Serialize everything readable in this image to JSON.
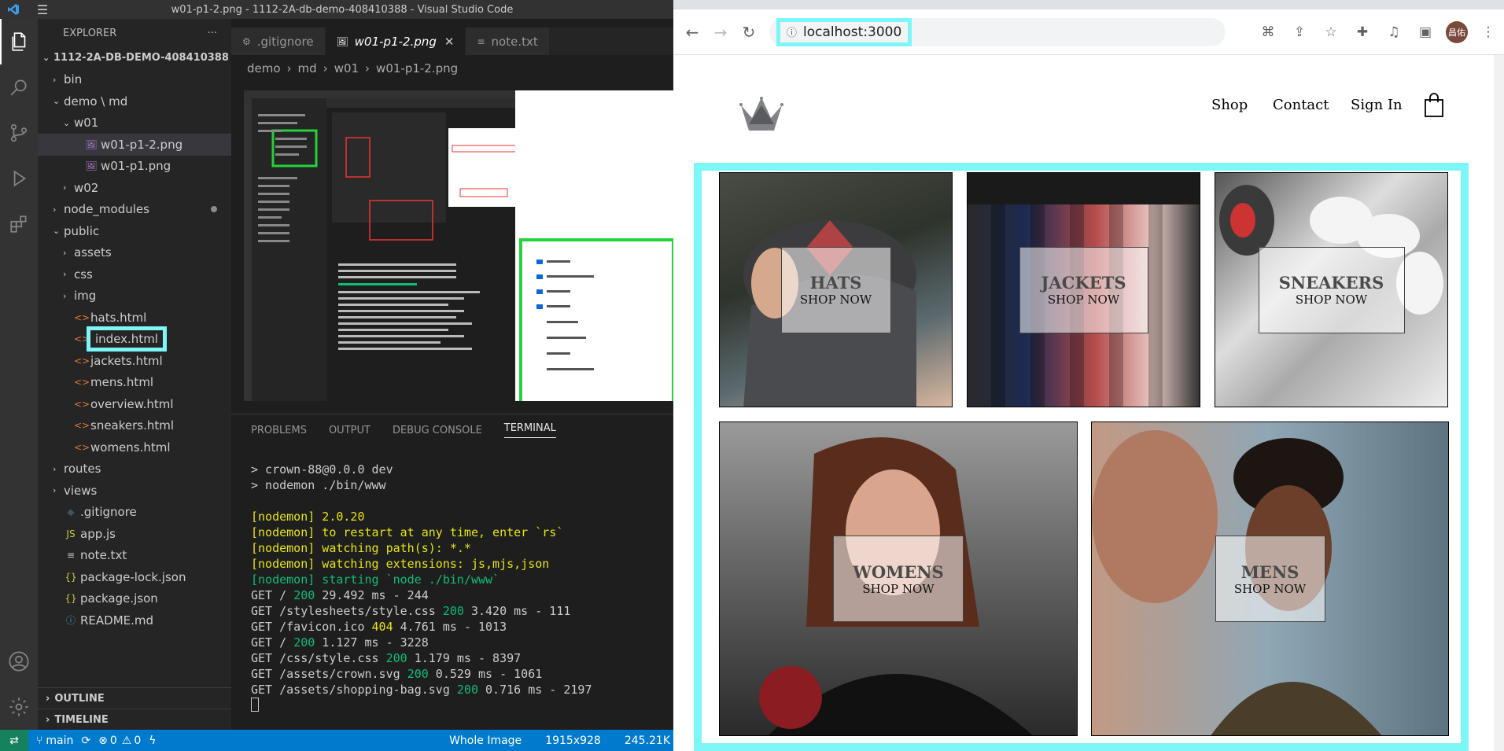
{
  "vscode": {
    "title": "w01-p1-2.png - 1112-2A-db-demo-408410388 - Visual Studio Code",
    "explorer_label": "EXPLORER",
    "tree": [
      {
        "label": "1112-2A-DB-DEMO-408410388",
        "indent": 0,
        "type": "root",
        "chev": "v"
      },
      {
        "label": "bin",
        "indent": 1,
        "type": "folder",
        "chev": ">"
      },
      {
        "label": "demo \\ md",
        "indent": 1,
        "type": "folder",
        "chev": "v"
      },
      {
        "label": "w01",
        "indent": 2,
        "type": "folder",
        "chev": "v"
      },
      {
        "label": "w01-p1-2.png",
        "indent": 3,
        "type": "image",
        "sel": true
      },
      {
        "label": "w01-p1.png",
        "indent": 3,
        "type": "image"
      },
      {
        "label": "w02",
        "indent": 2,
        "type": "folder",
        "chev": ">"
      },
      {
        "label": "node_modules",
        "indent": 1,
        "type": "folder",
        "chev": ">",
        "dot": true
      },
      {
        "label": "public",
        "indent": 1,
        "type": "folder",
        "chev": "v"
      },
      {
        "label": "assets",
        "indent": 2,
        "type": "folder",
        "chev": ">"
      },
      {
        "label": "css",
        "indent": 2,
        "type": "folder",
        "chev": ">"
      },
      {
        "label": "img",
        "indent": 2,
        "type": "folder",
        "chev": ">"
      },
      {
        "label": "hats.html",
        "indent": 2,
        "type": "html"
      },
      {
        "label": "index.html",
        "indent": 2,
        "type": "html",
        "hl": true
      },
      {
        "label": "jackets.html",
        "indent": 2,
        "type": "html"
      },
      {
        "label": "mens.html",
        "indent": 2,
        "type": "html"
      },
      {
        "label": "overview.html",
        "indent": 2,
        "type": "html"
      },
      {
        "label": "sneakers.html",
        "indent": 2,
        "type": "html"
      },
      {
        "label": "womens.html",
        "indent": 2,
        "type": "html"
      },
      {
        "label": "routes",
        "indent": 1,
        "type": "folder",
        "chev": ">"
      },
      {
        "label": "views",
        "indent": 1,
        "type": "folder",
        "chev": ">"
      },
      {
        "label": ".gitignore",
        "indent": 1,
        "type": "git"
      },
      {
        "label": "app.js",
        "indent": 1,
        "type": "js"
      },
      {
        "label": "note.txt",
        "indent": 1,
        "type": "txt"
      },
      {
        "label": "package-lock.json",
        "indent": 1,
        "type": "json"
      },
      {
        "label": "package.json",
        "indent": 1,
        "type": "json"
      },
      {
        "label": "README.md",
        "indent": 1,
        "type": "md"
      }
    ],
    "outline": "OUTLINE",
    "timeline": "TIMELINE",
    "tabs": [
      {
        "label": ".gitignore",
        "icon": "⚙",
        "active": false
      },
      {
        "label": "w01-p1-2.png",
        "icon": "🖼",
        "active": true,
        "close": "✕"
      },
      {
        "label": "note.txt",
        "icon": "≡",
        "active": false
      }
    ],
    "breadcrumb": [
      "demo",
      "md",
      "w01",
      "w01-p1-2.png"
    ],
    "panel_tabs": [
      "PROBLEMS",
      "OUTPUT",
      "DEBUG CONSOLE",
      "TERMINAL"
    ],
    "terminal": [
      {
        "t": "> crown-88@0.0.0 dev",
        "c": ""
      },
      {
        "t": "> nodemon ./bin/www",
        "c": ""
      },
      {
        "t": " ",
        "c": ""
      },
      {
        "t": "[nodemon] 2.0.20",
        "c": "y"
      },
      {
        "t": "[nodemon] to restart at any time, enter `rs`",
        "c": "y"
      },
      {
        "t": "[nodemon] watching path(s): *.*",
        "c": "y"
      },
      {
        "t": "[nodemon] watching extensions: js,mjs,json",
        "c": "y"
      },
      {
        "t": "[nodemon] starting `node ./bin/www`",
        "c": "g"
      }
    ],
    "requests": [
      {
        "pre": "GET / ",
        "code": "200",
        "post": " 29.492 ms - 244",
        "c": "g"
      },
      {
        "pre": "GET /stylesheets/style.css ",
        "code": "200",
        "post": " 3.420 ms - 111",
        "c": "g"
      },
      {
        "pre": "GET /favicon.ico ",
        "code": "404",
        "post": " 4.761 ms - 1013",
        "c": "y"
      },
      {
        "pre": "GET / ",
        "code": "200",
        "post": " 1.127 ms - 3228",
        "c": "g"
      },
      {
        "pre": "GET /css/style.css ",
        "code": "200",
        "post": " 1.179 ms - 8397",
        "c": "g"
      },
      {
        "pre": "GET /assets/crown.svg ",
        "code": "200",
        "post": " 0.529 ms - 1061",
        "c": "g"
      },
      {
        "pre": "GET /assets/shopping-bag.svg ",
        "code": "200",
        "post": " 0.716 ms - 2197",
        "c": "g"
      }
    ],
    "status": {
      "branch": "main",
      "errors": "0",
      "warnings": "0",
      "mode": "Whole Image",
      "dims": "1915x928",
      "size": "245.21K"
    }
  },
  "browser": {
    "url": "localhost:3000",
    "avatar": "昌佑",
    "nav": [
      "Shop",
      "Contact",
      "Sign In"
    ],
    "cards": [
      {
        "title": "HATS",
        "sub": "SHOP NOW"
      },
      {
        "title": "JACKETS",
        "sub": "SHOP NOW"
      },
      {
        "title": "SNEAKERS",
        "sub": "SHOP NOW"
      },
      {
        "title": "WOMENS",
        "sub": "SHOP NOW"
      },
      {
        "title": "MENS",
        "sub": "SHOP NOW"
      }
    ]
  }
}
